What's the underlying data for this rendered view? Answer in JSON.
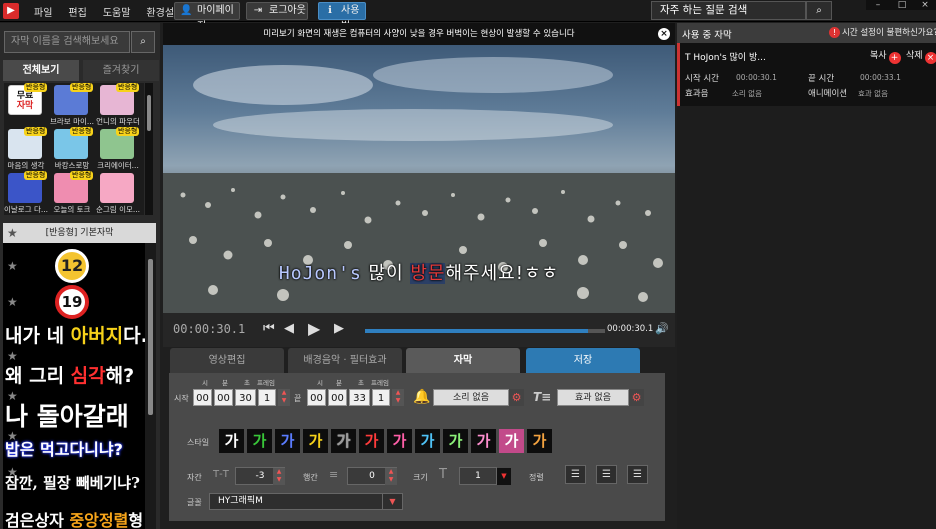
{
  "menu": [
    "파일",
    "편집",
    "도움말",
    "환경설정"
  ],
  "toolbar": {
    "mypage": "마이페이지",
    "logout": "로그아웃",
    "guide": "사용법"
  },
  "faq": {
    "label": "자주 하는 질문 검색"
  },
  "search": {
    "placeholder": "자막 이름을 검색해보세요"
  },
  "left_tabs": {
    "all": "전체보기",
    "favorites": "즐겨찾기"
  },
  "thumbs": [
    {
      "caption": "",
      "badge": "반응형",
      "color": "#ffffff"
    },
    {
      "caption": "브라보 마이...",
      "badge": "반응형",
      "color": "#5b7bd6"
    },
    {
      "caption": "언니의 파우더",
      "badge": "반응형",
      "color": "#e7b6d4"
    },
    {
      "caption": "마음의 생각",
      "badge": "반응형",
      "color": "#d9e4ef"
    },
    {
      "caption": "바캉스로망",
      "badge": "반응형",
      "color": "#7ac6e8"
    },
    {
      "caption": "크리에이터...",
      "badge": "반응형",
      "color": "#8fc58f"
    },
    {
      "caption": "이날로그 다...",
      "badge": "반응형",
      "color": "#3b55c8"
    },
    {
      "caption": "오늘의 토크",
      "badge": "반응형",
      "color": "#ef8db0"
    },
    {
      "caption": "순그림 이모...",
      "badge": "",
      "color": "#f6a8c4"
    }
  ],
  "thumb_first": {
    "line1": "무료",
    "line2": "자막"
  },
  "preset": {
    "header": "[반응형] 기본자막",
    "n12": "12",
    "n19": "19",
    "lines": [
      {
        "parts": [
          "내가 네 ",
          "아버지",
          "다."
        ]
      },
      {
        "parts": [
          "왜 그리 ",
          "심각",
          "해?"
        ]
      },
      {
        "text": "나 돌아갈래"
      },
      {
        "text": "밥은 먹고다니냐?"
      },
      {
        "text": "잠깐, 필장 빼베기냐?"
      },
      {
        "parts": [
          "검은상자 ",
          "중앙정렬",
          "형"
        ]
      }
    ]
  },
  "notice": "미리보기 화면의 재생은 컴퓨터의 사양이 낮을 경우 버벅이는 현상이 발생할 수 있습니다",
  "subtitle": {
    "name": "HoJon's",
    "mid1": " 많이 ",
    "hl": "방문",
    "rest": "해주세요!ㅎㅎ"
  },
  "player": {
    "current": "00:00:30.1",
    "end": "00:00:30.1",
    "progress_pct": 93
  },
  "tabs": {
    "edit": "영상편집",
    "bgm": "배경음악 · 필터효과",
    "subtitle": "자막",
    "save": "저장"
  },
  "editor": {
    "tf_labels": [
      "시",
      "분",
      "초",
      "프레임"
    ],
    "start_label": "시작",
    "end_label": "끝",
    "start": [
      "00",
      "00",
      "30",
      "1"
    ],
    "end": [
      "00",
      "00",
      "33",
      "1"
    ],
    "sound": "소리 없음",
    "effect": "효과 없음",
    "style_label": "스타일",
    "style_glyph": "가",
    "style_colors": [
      "#ffffff",
      "#39c739",
      "#5a7cff",
      "#f7d21a",
      "#9a9a9a",
      "#ff3b3b",
      "#ff5fa8",
      "#4fc3f7",
      "#8df27a",
      "#ff8fd0",
      "#ffffff",
      "#f4a340"
    ],
    "spacing_label": "자간",
    "spacing_value": "-3",
    "line_label": "행간",
    "line_value": "0",
    "size_label": "크기",
    "size_value": "1",
    "align_label": "정렬",
    "font_label": "글꼴",
    "font_value": "HY그래픽M"
  },
  "right": {
    "title": "사용 중 자막",
    "warn": "시간 설정이 불편하신가요?",
    "item": "HoJon's 많이 방...",
    "copy": "복사",
    "delete": "삭제",
    "start_label": "시작 시간",
    "start_val": "00:00:30.1",
    "end_label": "끝 시간",
    "end_val": "00:00:33.1",
    "sfx_label": "효과음",
    "sfx_val": "소리 없음",
    "anim_label": "애니메이션",
    "anim_val": "효과 없음"
  }
}
